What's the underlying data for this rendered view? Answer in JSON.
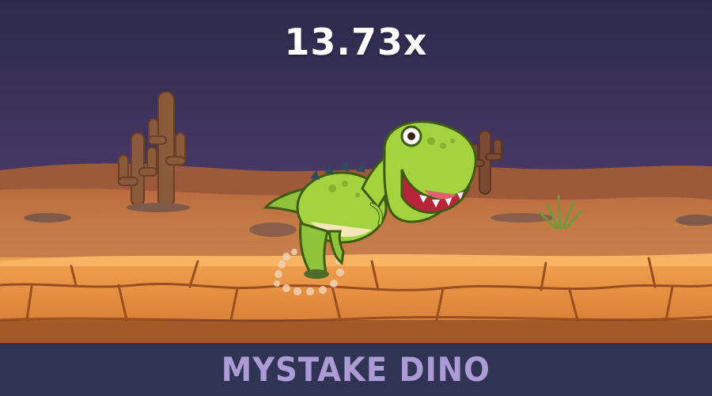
{
  "game": {
    "multiplier": "13.73x",
    "title": "MYSTAKE DINO"
  },
  "scene": {
    "character": "green-trex",
    "sky_color": "#3b2e5a",
    "ground_color": "#e08a3c",
    "footer_color": "#2f3354",
    "title_color": "#ad9bd6"
  }
}
